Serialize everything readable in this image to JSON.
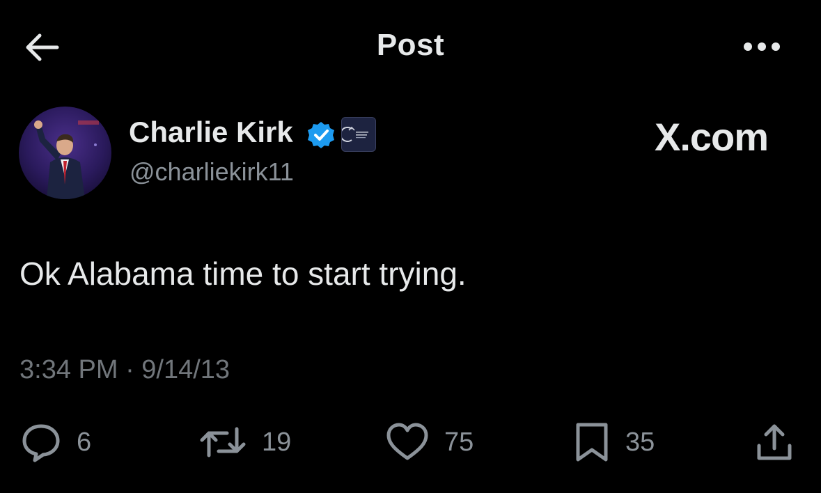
{
  "header": {
    "title": "Post",
    "back_icon": "arrow-left-icon",
    "more_icon": "more-horizontal-icon"
  },
  "author": {
    "display_name": "Charlie Kirk",
    "handle": "@charliekirk11",
    "verified": true,
    "verified_color": "#1d9bf0",
    "affiliate_badge_icon": "organization-badge-icon"
  },
  "watermark": "X.com",
  "post": {
    "text": "Ok Alabama time to start trying.",
    "timestamp": "3:34 PM · 9/14/13"
  },
  "actions": {
    "replies": "6",
    "reposts": "19",
    "likes": "75",
    "bookmarks": "35",
    "share_icon": "share-icon"
  },
  "colors": {
    "background": "#000000",
    "primary_text": "#e7e9ea",
    "secondary_text": "#71767b",
    "accent": "#1d9bf0"
  }
}
